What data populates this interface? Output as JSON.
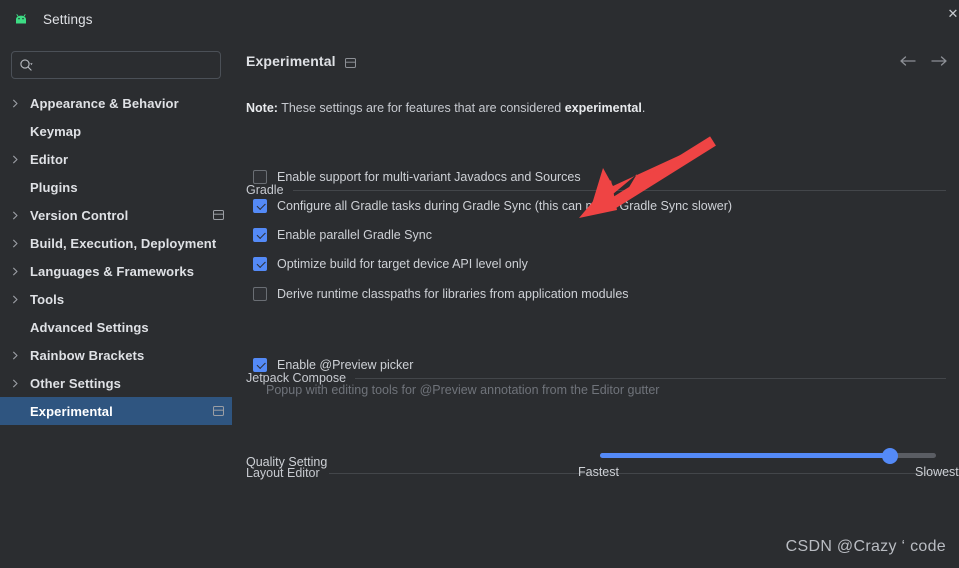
{
  "window": {
    "title": "Settings",
    "app_icon": "android-robot-icon",
    "close_label": "✕",
    "bg_color": "#2b2d30"
  },
  "search": {
    "value": "",
    "placeholder": "",
    "icon": "search-icon"
  },
  "sidebar": {
    "selected_index": 11,
    "selection_color": "#2f5580",
    "items": [
      {
        "label": "Appearance & Behavior",
        "expandable": true,
        "scope_badge": false
      },
      {
        "label": "Keymap",
        "expandable": false,
        "scope_badge": false
      },
      {
        "label": "Editor",
        "expandable": true,
        "scope_badge": false
      },
      {
        "label": "Plugins",
        "expandable": false,
        "scope_badge": false
      },
      {
        "label": "Version Control",
        "expandable": true,
        "scope_badge": true
      },
      {
        "label": "Build, Execution, Deployment",
        "expandable": true,
        "scope_badge": false
      },
      {
        "label": "Languages & Frameworks",
        "expandable": true,
        "scope_badge": false
      },
      {
        "label": "Tools",
        "expandable": true,
        "scope_badge": false
      },
      {
        "label": "Advanced Settings",
        "expandable": false,
        "scope_badge": false
      },
      {
        "label": "Rainbow Brackets",
        "expandable": true,
        "scope_badge": false
      },
      {
        "label": "Other Settings",
        "expandable": true,
        "scope_badge": false
      },
      {
        "label": "Experimental",
        "expandable": false,
        "scope_badge": true
      }
    ]
  },
  "content": {
    "title": "Experimental",
    "title_scope_badge": "project-scope-icon",
    "nav_back_icon": "arrow-left-icon",
    "nav_forward_icon": "arrow-right-icon",
    "note": {
      "prefix": "Note:",
      "middle": " These settings are for features that are considered ",
      "emphasis": "experimental",
      "suffix": "."
    },
    "groups": [
      {
        "label": "Gradle",
        "checkboxes": [
          {
            "label": "Enable support for multi-variant Javadocs and Sources",
            "checked": false,
            "focused": false
          },
          {
            "label": "Configure all Gradle tasks during Gradle Sync (this can make Gradle Sync slower)",
            "checked": true,
            "focused": true
          },
          {
            "label": "Enable parallel Gradle Sync",
            "checked": true,
            "focused": false
          },
          {
            "label": "Optimize build for target device API level only",
            "checked": true,
            "focused": false
          },
          {
            "label": "Derive runtime classpaths for libraries from application modules",
            "checked": false,
            "focused": false
          }
        ]
      },
      {
        "label": "Jetpack Compose",
        "checkboxes": [
          {
            "label": "Enable @Preview picker",
            "checked": true,
            "focused": false
          }
        ],
        "hint": "Popup with editing tools for @Preview annotation from the Editor gutter"
      },
      {
        "label": "Layout Editor",
        "slider": {
          "label": "Quality Setting",
          "min_label": "Fastest",
          "max_label": "Slowest",
          "value_percent": 88,
          "accent_color": "#548af7"
        }
      }
    ]
  },
  "annotation": {
    "arrow_color": "#ef4444",
    "name": "red-pointer-arrow"
  },
  "watermark": {
    "text": "CSDN @Crazy ‘ code"
  }
}
